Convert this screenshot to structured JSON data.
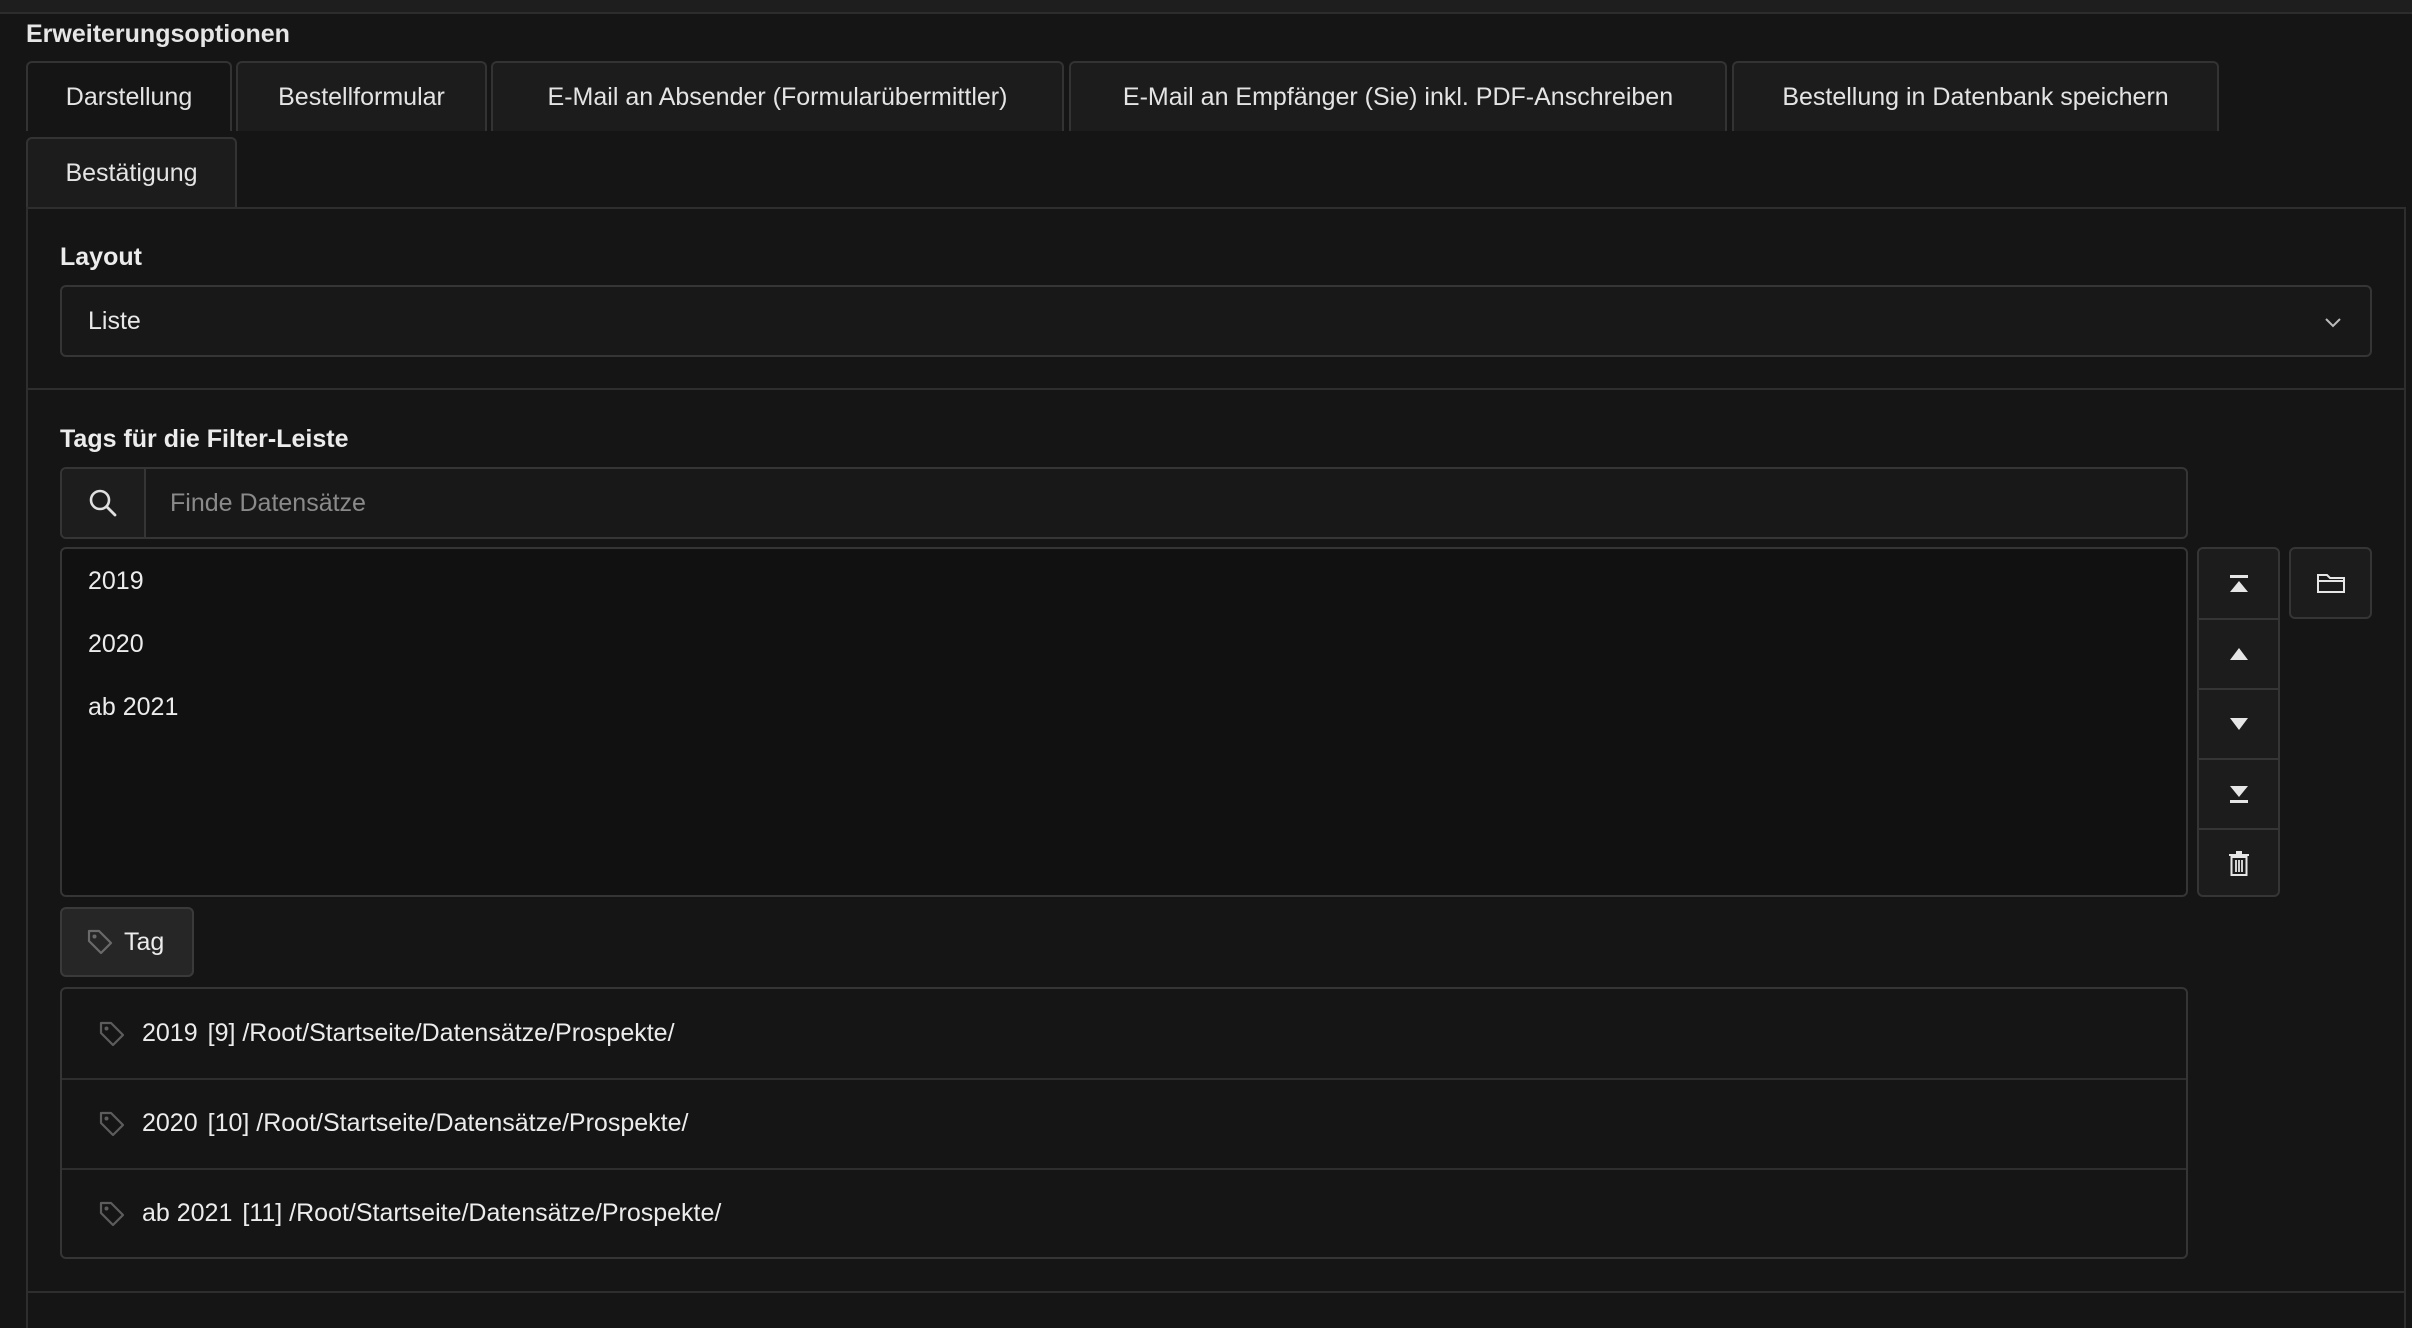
{
  "section": {
    "title": "Erweiterungsoptionen"
  },
  "tabs": [
    {
      "label": "Darstellung"
    },
    {
      "label": "Bestellformular"
    },
    {
      "label": "E-Mail an Absender (Formularübermittler)"
    },
    {
      "label": "E-Mail an Empfänger (Sie) inkl. PDF-Anschreiben"
    },
    {
      "label": "Bestellung in Datenbank speichern"
    },
    {
      "label": "Bestätigung"
    }
  ],
  "layout": {
    "label": "Layout",
    "selected": "Liste"
  },
  "tags": {
    "label": "Tags für die Filter-Leiste",
    "search_placeholder": "Finde Datensätze",
    "selected_items": [
      "2019",
      "2020",
      "ab 2021"
    ],
    "add_button_label": "Tag",
    "records": [
      {
        "title": "2019",
        "meta": "[9] /Root/Startseite/Datensätze/Prospekte/"
      },
      {
        "title": "2020",
        "meta": "[10] /Root/Startseite/Datensätze/Prospekte/"
      },
      {
        "title": "ab 2021",
        "meta": "[11] /Root/Startseite/Datensätze/Prospekte/"
      }
    ]
  },
  "colors": {
    "background": "#151515",
    "border": "#353535",
    "text": "#e8e8e8"
  },
  "icons": {
    "search": "search-icon",
    "chevron": "chevron-down-icon",
    "move_top": "move-to-top-icon",
    "move_up": "move-up-icon",
    "move_down": "move-down-icon",
    "move_bottom": "move-to-bottom-icon",
    "delete": "trash-icon",
    "browse": "folder-icon",
    "tag": "tag-icon"
  }
}
